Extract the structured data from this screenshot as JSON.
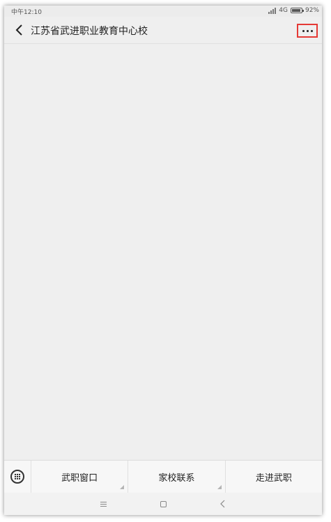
{
  "status_bar": {
    "time": "中午12:10",
    "network": "4G",
    "battery": "92%",
    "battery_level": 0.92
  },
  "header": {
    "back_icon": "chevron-left-icon",
    "title": "江苏省武进职业教育中心校",
    "more_icon": "more-horizontal-icon",
    "highlight_color": "#e53935"
  },
  "menu_bar": {
    "keyboard_icon": "keyboard-icon",
    "items": [
      {
        "label": "武职窗口",
        "has_submenu": true
      },
      {
        "label": "家校联系",
        "has_submenu": true
      },
      {
        "label": "走进武职",
        "has_submenu": false
      }
    ]
  },
  "system_nav": {
    "menu_icon": "menu-icon",
    "home_icon": "home-icon",
    "back_icon": "back-icon"
  }
}
